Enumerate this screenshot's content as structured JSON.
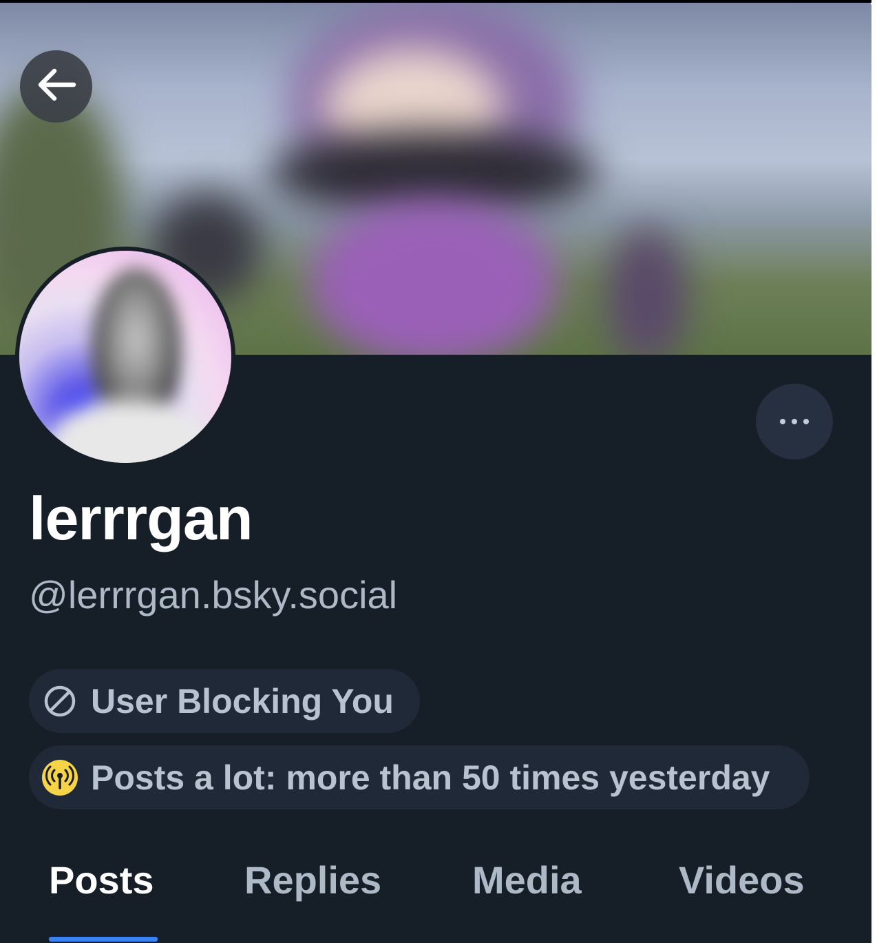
{
  "profile": {
    "display_name": "lerrrgan",
    "handle": "@lerrrgan.bsky.social"
  },
  "labels": [
    {
      "icon": "block-icon",
      "text": "User Blocking You"
    },
    {
      "icon": "broadcast-icon",
      "text": "Posts a lot: more than 50 times yesterday"
    }
  ],
  "tabs": [
    {
      "label": "Posts",
      "active": true
    },
    {
      "label": "Replies",
      "active": false
    },
    {
      "label": "Media",
      "active": false
    },
    {
      "label": "Videos",
      "active": false
    }
  ],
  "colors": {
    "background": "#161e27",
    "accent": "#3b82f6",
    "pill_bg": "#1f2937",
    "muted_text": "#aeb9c7",
    "badge_yellow": "#f5d547"
  },
  "icons": {
    "back": "arrow-left-icon",
    "more": "more-dots-icon"
  }
}
